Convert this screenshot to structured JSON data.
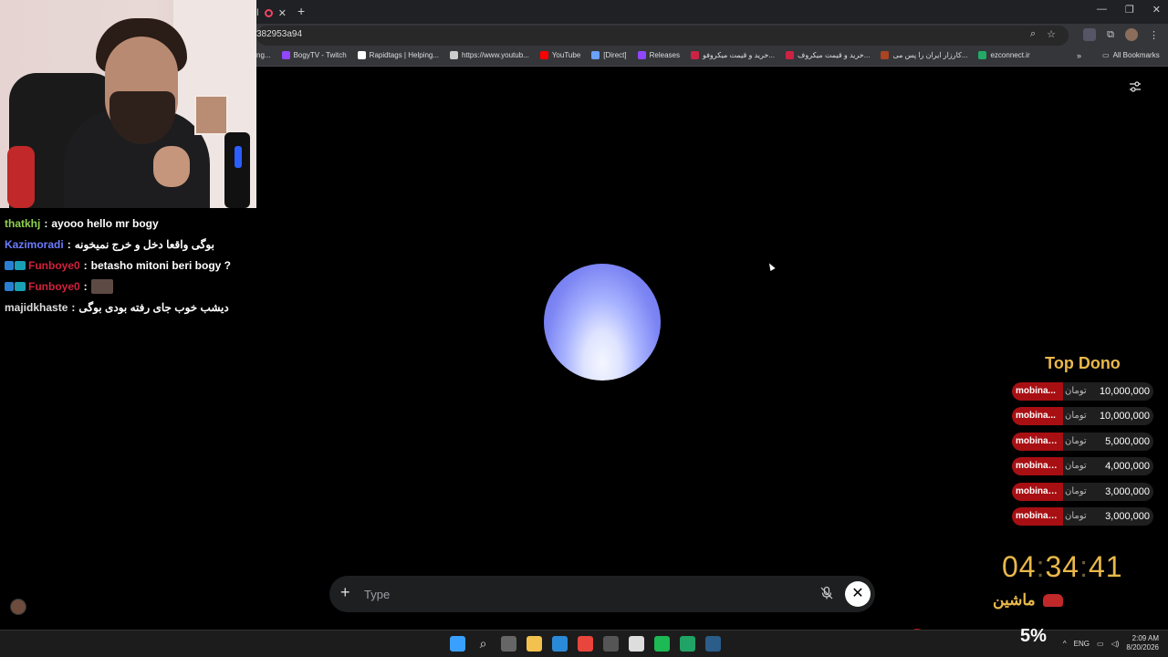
{
  "browser": {
    "tab_partial": "ا",
    "url": "382953a94",
    "bookmarks": [
      {
        "label": "ng...",
        "color": "#444"
      },
      {
        "label": "BogyTV - Twitch",
        "color": "#9146ff"
      },
      {
        "label": "Rapidtags | Helping...",
        "color": "#ffffff"
      },
      {
        "label": "https://www.youtub...",
        "color": "#cccccc"
      },
      {
        "label": "YouTube",
        "color": "#ff0000"
      },
      {
        "label": "[Direct]",
        "color": "#6aa0ff"
      },
      {
        "label": "Releases",
        "color": "#9146ff"
      },
      {
        "label": "خرید و قیمت میکروفو...",
        "color": "#cc2244"
      },
      {
        "label": "خرید و قیمت میکروف...",
        "color": "#cc2244"
      },
      {
        "label": "کارزار ایران را پس می...",
        "color": "#aa4422"
      },
      {
        "label": "ezconnect.ir",
        "color": "#22aa66"
      }
    ],
    "bookmarks_more": "»",
    "all_bookmarks": "All Bookmarks"
  },
  "chat": {
    "messages": [
      {
        "user": "thatkhj",
        "user_color": "#8fd14f",
        "text": "ayooo hello mr bogy",
        "badges": false
      },
      {
        "user": "Kazimoradi",
        "user_color": "#6b7cff",
        "text": "بوگی واقعا دخل و خرج نمیخونه",
        "badges": false
      },
      {
        "user": "Funboye0",
        "user_color": "#d2213c",
        "text": "betasho mitoni beri bogy ?",
        "badges": true
      },
      {
        "user": "Funboye0",
        "user_color": "#d2213c",
        "text": "",
        "badges": true,
        "emote": true
      },
      {
        "user": "majidkhaste",
        "user_color": "#dddddd",
        "text": "دیشب خوب جای رفته بودی بوگی",
        "badges": false
      }
    ]
  },
  "main": {
    "input_placeholder": "Type",
    "icons": {
      "settings": "sliders-icon",
      "add": "plus-icon",
      "mic": "mic-off-icon",
      "close": "close-icon"
    }
  },
  "dono": {
    "title": "Top Dono",
    "currency": "تومان",
    "entries": [
      {
        "name": "mobina...",
        "amount": "10,000,000"
      },
      {
        "name": "mobina...",
        "amount": "10,000,000"
      },
      {
        "name": "mobinam...",
        "amount": "5,000,000"
      },
      {
        "name": "mobinam...",
        "amount": "4,000,000"
      },
      {
        "name": "mobinam...",
        "amount": "3,000,000"
      },
      {
        "name": "mobinam...",
        "amount": "3,000,000"
      }
    ]
  },
  "timer": {
    "h": "04",
    "m": "34",
    "s": "41",
    "sep": ":"
  },
  "car_label": "ماشین",
  "taskbar": {
    "percent": "5%",
    "lang": "ENG",
    "time": "2:09 AM",
    "date": "8/20/2026",
    "apps": [
      {
        "name": "windows-start-icon",
        "color": "#3aa0ff"
      },
      {
        "name": "search-icon",
        "color": "#1c1c1c"
      },
      {
        "name": "task-view-icon",
        "color": "#666666"
      },
      {
        "name": "file-explorer-icon",
        "color": "#f2c14e"
      },
      {
        "name": "vscode-icon",
        "color": "#2b8ad8"
      },
      {
        "name": "chrome-icon",
        "color": "#e8453c"
      },
      {
        "name": "app-icon",
        "color": "#555555"
      },
      {
        "name": "capcut-icon",
        "color": "#dddddd"
      },
      {
        "name": "spotify-icon",
        "color": "#1db954"
      },
      {
        "name": "sheets-icon",
        "color": "#21a366"
      },
      {
        "name": "steam-icon",
        "color": "#2a5d8a"
      }
    ]
  }
}
